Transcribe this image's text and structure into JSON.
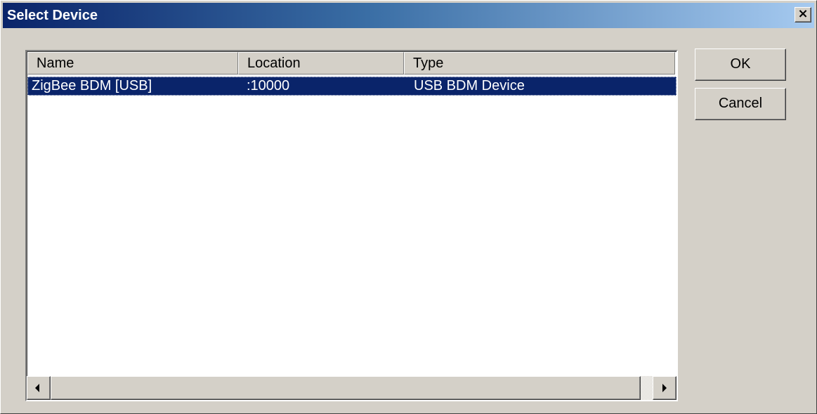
{
  "window": {
    "title": "Select Device",
    "close_glyph": "×"
  },
  "listview": {
    "columns": [
      "Name",
      "Location",
      "Type"
    ],
    "rows": [
      {
        "name": "ZigBee BDM [USB]",
        "location": ":10000",
        "type": "USB BDM Device",
        "selected": true
      }
    ]
  },
  "buttons": {
    "ok": "OK",
    "cancel": "Cancel"
  },
  "icons": [
    "close-icon",
    "scroll-left-arrow-icon",
    "scroll-right-arrow-icon"
  ],
  "colors": {
    "title_gradient_start": "#0a246a",
    "title_gradient_end": "#a6caf0",
    "selection": "#0a246a",
    "face": "#d4d0c8"
  }
}
